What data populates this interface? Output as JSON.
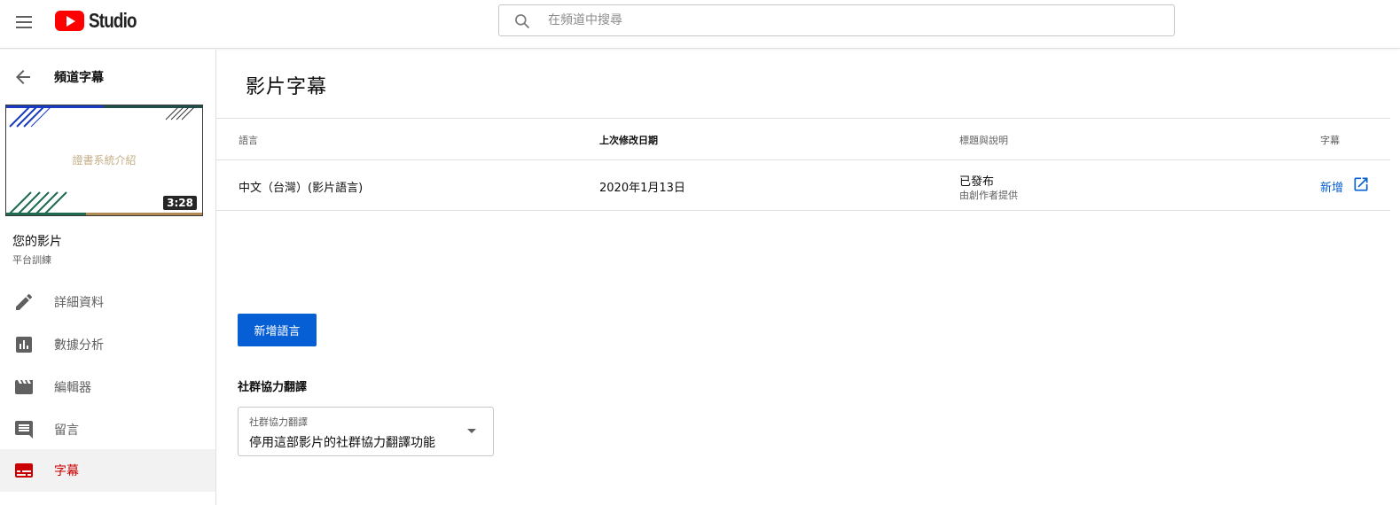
{
  "app": {
    "brand_label": "Studio",
    "search_placeholder": "在頻道中搜尋"
  },
  "sidebar": {
    "back_title": "頻道字幕",
    "thumbnail": {
      "title_text": "證書系統介紹",
      "duration": "3:28"
    },
    "video_label": "您的影片",
    "channel_name": "平台訓練",
    "items": [
      {
        "label": "詳細資料",
        "icon": "pencil-icon",
        "active": false
      },
      {
        "label": "數據分析",
        "icon": "analytics-icon",
        "active": false
      },
      {
        "label": "編輯器",
        "icon": "film-icon",
        "active": false
      },
      {
        "label": "留言",
        "icon": "comment-icon",
        "active": false
      },
      {
        "label": "字幕",
        "icon": "subtitles-icon",
        "active": true
      }
    ]
  },
  "main": {
    "page_title": "影片字幕",
    "table": {
      "headers": {
        "language": "語言",
        "modified": "上次修改日期",
        "title_desc": "標題與說明",
        "subtitles": "字幕"
      },
      "rows": [
        {
          "language": "中文（台灣）(影片語言)",
          "modified": "2020年1月13日",
          "status": "已發布",
          "status_sub": "由創作者提供",
          "subtitle_action": "新增"
        }
      ]
    },
    "add_language_button": "新增語言",
    "community": {
      "heading": "社群協力翻譯",
      "select_label": "社群協力翻譯",
      "select_value": "停用這部影片的社群協力翻譯功能"
    }
  },
  "colors": {
    "brand_red": "#ff0000",
    "active_red": "#cc0000",
    "link_blue": "#065fd4",
    "thumb_blue": "#1a3bbf",
    "thumb_green": "#1f6b4f",
    "thumb_gold": "#b08a52"
  }
}
